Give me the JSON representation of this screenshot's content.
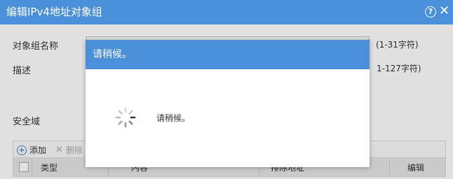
{
  "dialog": {
    "title": "编辑IPv4地址对象组",
    "help_icon": "help-icon",
    "close_icon": "close-icon"
  },
  "form": {
    "name_label": "对象组名称",
    "name_value": "",
    "name_required_mark": "*",
    "name_hint": "(1-31字符)",
    "desc_label": "描述",
    "desc_hint": "1-127字符)",
    "zone_label": "安全域"
  },
  "toolbar": {
    "add_label": "添加",
    "delete_label": "删除"
  },
  "table": {
    "columns": [
      "类型",
      "内容",
      "排除地址",
      "编辑"
    ]
  },
  "loading": {
    "title": "请稍候。",
    "message": "请稍候。"
  },
  "colors": {
    "accent": "#4a90d9",
    "required": "#e53935"
  }
}
